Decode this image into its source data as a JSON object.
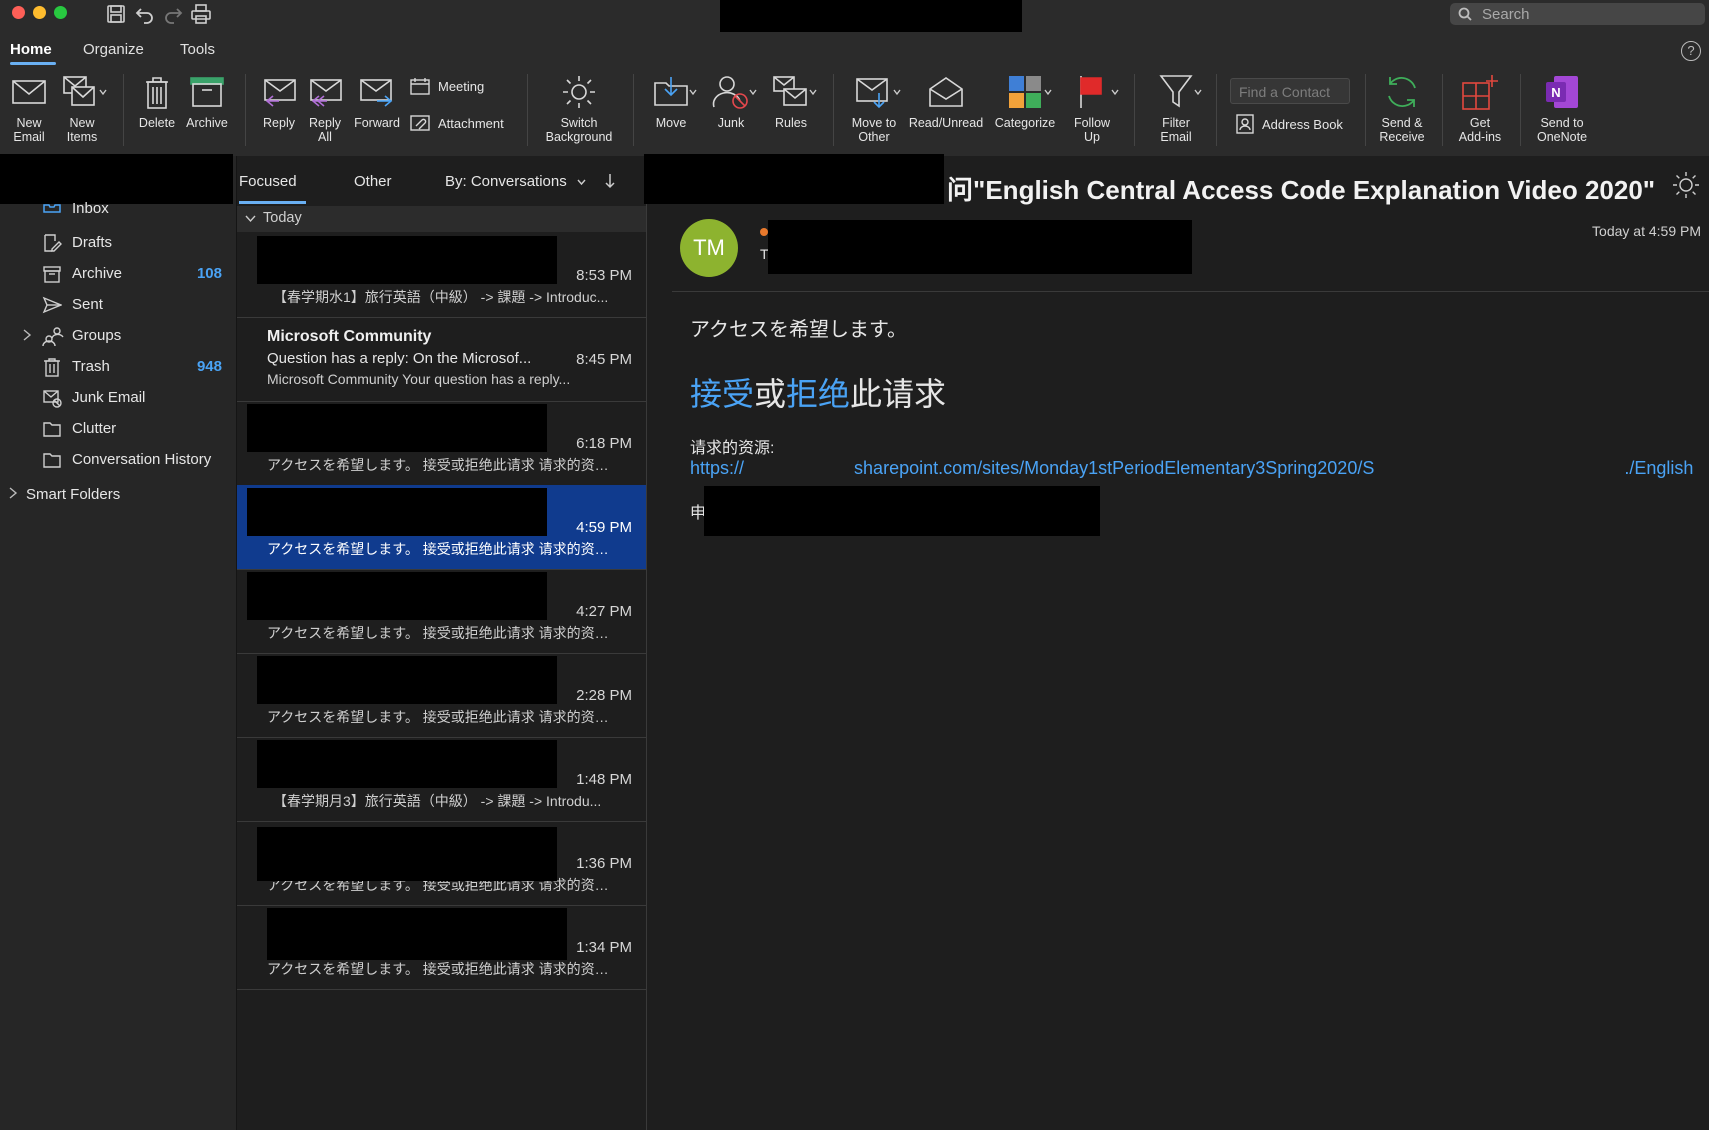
{
  "titlebar": {
    "search_placeholder": "Search"
  },
  "tabs": [
    "Home",
    "Organize",
    "Tools"
  ],
  "ribbon": {
    "new_email": [
      "New",
      "Email"
    ],
    "new_items": [
      "New",
      "Items"
    ],
    "delete": "Delete",
    "archive": "Archive",
    "reply": "Reply",
    "reply_all": [
      "Reply",
      "All"
    ],
    "forward": "Forward",
    "meeting": "Meeting",
    "attachment": "Attachment",
    "switch_background": [
      "Switch",
      "Background"
    ],
    "move": "Move",
    "junk": "Junk",
    "rules": "Rules",
    "move_to_other": [
      "Move to",
      "Other"
    ],
    "read_unread": "Read/Unread",
    "categorize": "Categorize",
    "follow_up": [
      "Follow",
      "Up"
    ],
    "filter_email": [
      "Filter",
      "Email"
    ],
    "find_contact_placeholder": "Find a Contact",
    "address_book": "Address Book",
    "send_receive": [
      "Send &",
      "Receive"
    ],
    "get_addins": [
      "Get",
      "Add-ins"
    ],
    "send_onenote": [
      "Send to",
      "OneNote"
    ]
  },
  "sidebar": {
    "folders": [
      {
        "label": "Inbox",
        "count": ""
      },
      {
        "label": "Drafts",
        "count": ""
      },
      {
        "label": "Archive",
        "count": "108"
      },
      {
        "label": "Sent",
        "count": ""
      },
      {
        "label": "Groups",
        "count": ""
      },
      {
        "label": "Trash",
        "count": "948"
      },
      {
        "label": "Junk Email",
        "count": ""
      },
      {
        "label": "Clutter",
        "count": ""
      },
      {
        "label": "Conversation History",
        "count": ""
      }
    ],
    "smart_folders": "Smart Folders"
  },
  "list": {
    "tab_focused": "Focused",
    "tab_other": "Other",
    "sort": "By: Conversations",
    "group_header": "Today",
    "messages": [
      {
        "sender": "",
        "subject": "",
        "time": "8:53 PM",
        "preview": "【春学期水1】旅行英語（中級） -> 課題 -> Introduc..."
      },
      {
        "sender": "Microsoft Community",
        "subject": "Question has a reply: On the Microsof...",
        "time": "8:45 PM",
        "preview": "Microsoft Community Your question has a reply..."
      },
      {
        "sender": "",
        "subject": "",
        "time": "6:18 PM",
        "preview": "アクセスを希望します。 接受或拒绝此请求 请求的资…"
      },
      {
        "sender": "",
        "subject": "",
        "time": "4:59 PM",
        "preview": "アクセスを希望します。 接受或拒绝此请求 请求的资…"
      },
      {
        "sender": "",
        "subject": "",
        "time": "4:27 PM",
        "preview": "アクセスを希望します。 接受或拒绝此请求 请求的资…"
      },
      {
        "sender": "",
        "subject": "",
        "time": "2:28 PM",
        "preview": "アクセスを希望します。 接受或拒绝此请求 请求的资…"
      },
      {
        "sender": "",
        "subject": "",
        "time": "1:48 PM",
        "preview": "【春学期月3】旅行英語（中級） -> 課題 -> Introdu..."
      },
      {
        "sender": "",
        "subject": "",
        "time": "1:36 PM",
        "preview": "アクセスを希望します。 接受或拒绝此请求 请求的资…"
      },
      {
        "sender": "",
        "subject": "",
        "time": "1:34 PM",
        "preview": "アクセスを希望します。 接受或拒绝此请求 请求的资…"
      }
    ]
  },
  "reading": {
    "subject": "\"English Central Access Code Explanation Video 2020\"",
    "avatar_initials": "TM",
    "datetime": "Today at 4:59 PM",
    "body_line1": "アクセスを希望します。",
    "accept": "接受",
    "or": "或",
    "reject": "拒绝",
    "this_request": "此请求",
    "resource_label": "请求的资源:",
    "resource_url": "https://                      sharepoint.com/sites/Monday1stPeriodElementary3Spring2020/S                                                  ./English",
    "applicant_label": "申"
  },
  "colors": {
    "accent_blue": "#4aa3f5",
    "selected_row": "#103b8e",
    "avatar_green": "#8db32f"
  }
}
